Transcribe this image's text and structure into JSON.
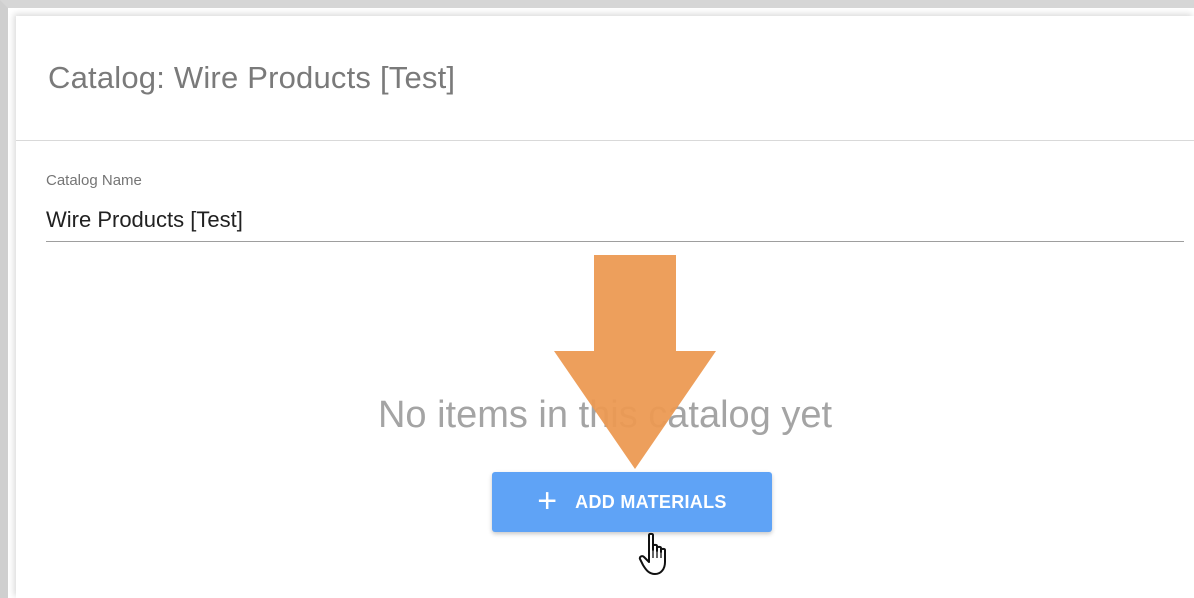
{
  "header": {
    "title": "Catalog: Wire Products [Test]"
  },
  "form": {
    "catalog_name_label": "Catalog Name",
    "catalog_name_value": "Wire Products [Test]"
  },
  "empty_state": {
    "message": "No items in this catalog yet",
    "add_button_label": "ADD MATERIALS",
    "add_button_icon": "plus-icon"
  },
  "annotation": {
    "arrow_color": "#ec9a53",
    "cursor_icon": "hand-pointer-icon"
  },
  "colors": {
    "button_blue": "#5fa3f6",
    "title_gray": "#7a7a7a"
  }
}
